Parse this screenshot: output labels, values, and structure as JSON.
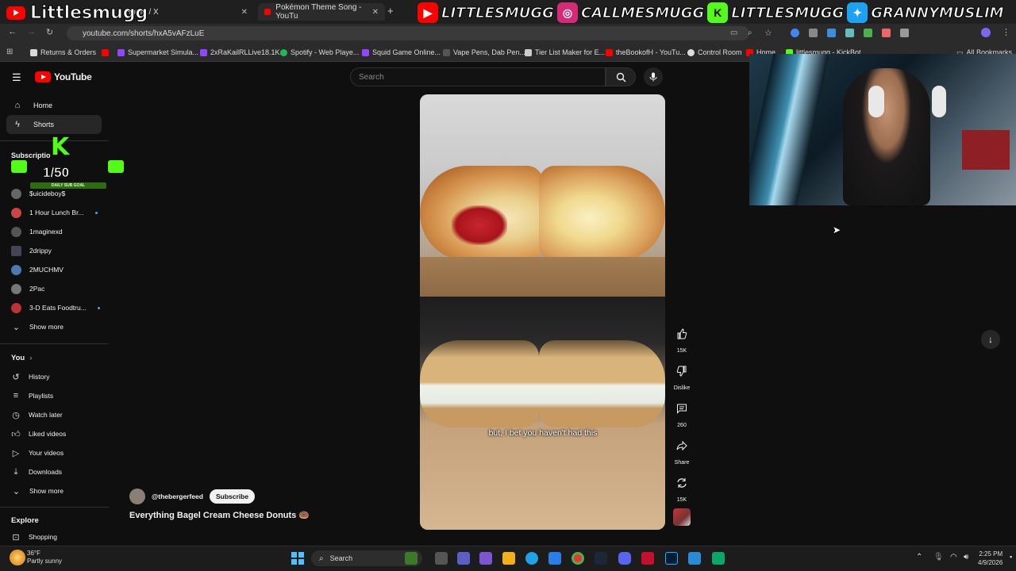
{
  "browser": {
    "tabs": [
      {
        "label": "Home / X"
      },
      {
        "label": "Pokémon Theme Song - YouTu"
      }
    ],
    "url": "youtube.com/shorts/hxA5vAFzLuE",
    "bookmarks": [
      {
        "label": "Returns & Orders",
        "color": "#d9d9d9"
      },
      {
        "label": "Supermarket Simula...",
        "color": "#9146ff"
      },
      {
        "label": "2xRaKailRLLive18.1K...",
        "color": "#9146ff"
      },
      {
        "label": "Spotify - Web Playe...",
        "color": "#1db954"
      },
      {
        "label": "Squid Game Online...",
        "color": "#9146ff"
      },
      {
        "label": "Vape Pens, Dab Pen...",
        "color": "#555555"
      },
      {
        "label": "Tier List Maker for E...",
        "color": "#cccccc"
      },
      {
        "label": "theBookofH - YouTu...",
        "color": "#ff0000"
      },
      {
        "label": "Control Room",
        "color": "#dddddd"
      },
      {
        "label": "Home",
        "color": "#ff0000"
      },
      {
        "label": "littlesmugg - KickBot",
        "color": "#53fc18"
      }
    ],
    "all_bookmarks": "All Bookmarks"
  },
  "overlay": {
    "streamer": "Littlesmugg",
    "handles": [
      {
        "text": "LITTLESMUGG",
        "icon": "youtube-icon",
        "color": "#ff0000"
      },
      {
        "text": "CALLMESMUGG",
        "icon": "instagram-icon",
        "color": "#d62976"
      },
      {
        "text": "LITTLESMUGG",
        "icon": "kick-icon",
        "color": "#53fc18"
      },
      {
        "text": "GRANNYMUSLIM",
        "icon": "twitter-icon",
        "color": "#1da1f2"
      }
    ],
    "sub_goal_count": "1/50",
    "sub_goal_label": "DAILY SUB GOAL",
    "sub_goal_letter": "K"
  },
  "youtube": {
    "logo_text": "YouTube",
    "search_placeholder": "Search",
    "nav": [
      {
        "label": "Home",
        "icon": "home-icon"
      },
      {
        "label": "Shorts",
        "icon": "shorts-icon"
      }
    ],
    "subscriptions_title": "Subscriptio",
    "subscriptions": [
      {
        "label": "$uicideboy$",
        "color": "#666666",
        "live": false
      },
      {
        "label": "1 Hour Lunch Br...",
        "color": "#c44",
        "live": true
      },
      {
        "label": "1maginexd",
        "color": "#555555",
        "live": false
      },
      {
        "label": "2drippy",
        "color": "#445",
        "live": false
      },
      {
        "label": "2MUCHMV",
        "color": "#4a7ab0",
        "live": false
      },
      {
        "label": "2Pac",
        "color": "#777777",
        "live": false
      },
      {
        "label": "3-D Eats Foodtru...",
        "color": "#b33",
        "live": true
      }
    ],
    "show_more": "Show more",
    "you_title": "You",
    "you_items": [
      {
        "label": "History",
        "icon": "history-icon"
      },
      {
        "label": "Playlists",
        "icon": "playlists-icon"
      },
      {
        "label": "Watch later",
        "icon": "watch-later-icon"
      },
      {
        "label": "Liked videos",
        "icon": "like-icon"
      },
      {
        "label": "Your videos",
        "icon": "your-videos-icon"
      },
      {
        "label": "Downloads",
        "icon": "download-icon"
      }
    ],
    "show_more_2": "Show more",
    "explore_title": "Explore",
    "explore_items": [
      {
        "label": "Shopping",
        "icon": "shopping-icon"
      }
    ],
    "short": {
      "caption": "but, I bet you haven't had this",
      "channel": "@thebergerfeed",
      "subscribe": "Subscribe",
      "title": "Everything Bagel Cream Cheese Donuts 🍩"
    },
    "actions": [
      {
        "name": "like",
        "count": "15K"
      },
      {
        "name": "dislike",
        "count": "Dislike"
      },
      {
        "name": "comments",
        "count": "260"
      },
      {
        "name": "share",
        "count": "Share"
      },
      {
        "name": "remix",
        "count": "15K"
      }
    ]
  },
  "taskbar": {
    "weather_temp": "36°F",
    "weather_desc": "Partly sunny",
    "search_label": "Search",
    "time": "2:25 PM",
    "date": "4/9/2026"
  }
}
